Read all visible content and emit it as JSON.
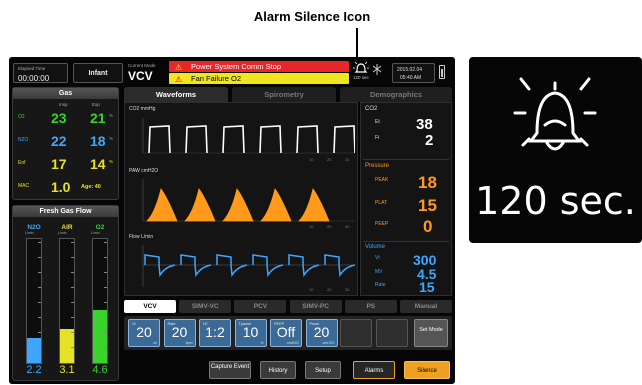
{
  "callout": {
    "title": "Alarm Silence Icon"
  },
  "topbar": {
    "elapsed_label": "Elapsed Time",
    "elapsed_value": "00:00:00",
    "patient": "Infant",
    "mode_label": "Current Mode",
    "mode": "VCV",
    "alarm_high": "Power System Comm Stop",
    "alarm_medium": "Fan Failure O2",
    "silence_seconds": "120 sec",
    "date": "2015.02.04",
    "time": "05:40 AM"
  },
  "gas": {
    "title": "Gas",
    "col_insp": "Insp",
    "col_exp": "Exp",
    "rows": [
      {
        "label": "O2",
        "insp": "23",
        "exp": "21",
        "unit": "%"
      },
      {
        "label": "N2O",
        "insp": "22",
        "exp": "18",
        "unit": "%"
      },
      {
        "label": "Enf",
        "insp": "17",
        "exp": "14",
        "unit": "%"
      }
    ],
    "mac_label": "MAC",
    "mac_value": "1.0",
    "age": "Age: 40"
  },
  "fresh_gas": {
    "title": "Fresh Gas Flow",
    "meters": [
      {
        "name": "N2O",
        "value": "2.2",
        "level": 0.2,
        "color": "#3fa6ff"
      },
      {
        "name": "AIR",
        "value": "3.1",
        "level": 0.27,
        "color": "#e6e22a"
      },
      {
        "name": "O2",
        "value": "4.6",
        "level": 0.42,
        "color": "#39d32c"
      }
    ],
    "scale_top": "15",
    "scale_mid": "10",
    "scale_low": "5",
    "unit": "L/min"
  },
  "tabs": [
    "Waveforms",
    "Spirometry",
    "Demographics"
  ],
  "waves": {
    "co2_label": "CO2 mmHg",
    "paw_label": "PAW cmH2O",
    "flow_label": "Flow L/min",
    "axis_values": [
      "10",
      "20",
      "30"
    ],
    "co2_color": "#ffffff",
    "paw_color": "#ff9a1a",
    "flow_color": "#3fa6ff"
  },
  "readings": {
    "co2_title": "CO2",
    "et_label": "Et",
    "et_value": "38",
    "fi_label": "Fi",
    "fi_value": "2",
    "pressure_title": "Pressure",
    "peak_label": "PEAK",
    "peak_value": "18",
    "plat_label": "PLAT",
    "plat_value": "15",
    "peep_label": "PEEP",
    "peep_value": "0",
    "volume_title": "Volume",
    "vt_label": "Vt",
    "vt_value": "300",
    "mv_label": "MV",
    "mv_value": "4.5",
    "rate_label": "Rate",
    "rate_value": "15"
  },
  "modes": [
    "VCV",
    "SIMV-VC",
    "PCV",
    "SIMV-PC",
    "PS",
    "Manual"
  ],
  "settings": [
    {
      "label": "Vt",
      "value": "20",
      "unit": "ml"
    },
    {
      "label": "Rate",
      "value": "20",
      "unit": "bpm"
    },
    {
      "label": "I:E",
      "value": "1:2",
      "unit": ""
    },
    {
      "label": "Tpause",
      "value": "10",
      "unit": "%"
    },
    {
      "label": "PEEP",
      "value": "Off",
      "unit": "cmH2O"
    },
    {
      "label": "Pmax",
      "value": "20",
      "unit": "cmH2O"
    }
  ],
  "set_mode_label": "Set Mode",
  "buttons": {
    "capture": "Capture Event",
    "history": "History",
    "setup": "Setup",
    "alarms": "Alarms",
    "silence": "Silence"
  },
  "zoom_text": "120 sec."
}
